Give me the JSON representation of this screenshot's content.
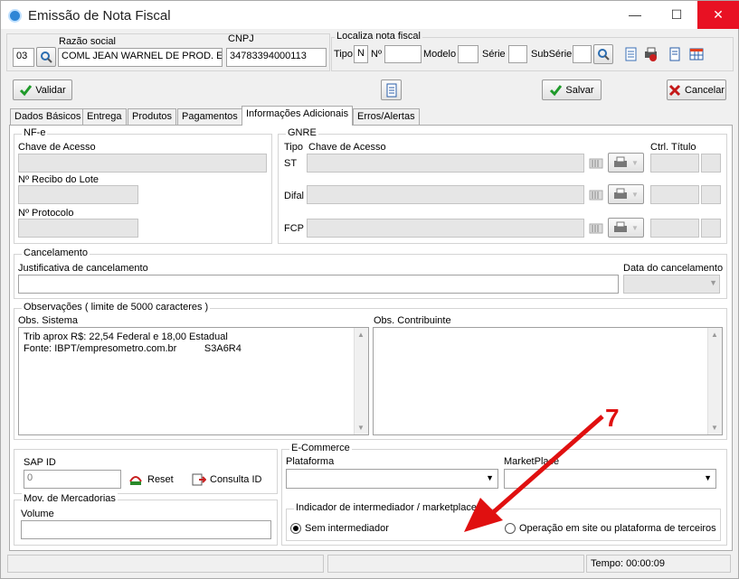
{
  "window": {
    "title": "Emissão de Nota Fiscal",
    "minimize": "—",
    "maximize": "☐",
    "close": "✕"
  },
  "header": {
    "code_value": "03",
    "razao_label": "Razão social",
    "razao_value": "COML JEAN WARNEL DE PROD. ESP.",
    "cnpj_label": "CNPJ",
    "cnpj_value": "34783394000113",
    "localiza_label": "Localiza nota fiscal",
    "tipo_label": "Tipo",
    "tipo_value": "N",
    "no_label": "Nº",
    "modelo_label": "Modelo",
    "serie_label": "Série",
    "subserie_label": "SubSérie"
  },
  "toolbar": {
    "validar": "Validar",
    "salvar": "Salvar",
    "cancelar": "Cancelar"
  },
  "tabs": [
    {
      "label": "Dados Básicos"
    },
    {
      "label": "Entrega"
    },
    {
      "label": "Produtos"
    },
    {
      "label": "Pagamentos"
    },
    {
      "label": "Informações Adicionais"
    },
    {
      "label": "Erros/Alertas"
    }
  ],
  "nfe": {
    "title": "NF-e",
    "chave_label": "Chave de Acesso",
    "recibo_label": "Nº Recibo do Lote",
    "protocolo_label": "Nº Protocolo"
  },
  "gnre": {
    "title": "GNRE",
    "tipo_label": "Tipo",
    "chave_label": "Chave de Acesso",
    "ctrl_label": "Ctrl. Título",
    "rows": [
      {
        "label": "ST"
      },
      {
        "label": "Difal"
      },
      {
        "label": "FCP"
      }
    ]
  },
  "cancelamento": {
    "title": "Cancelamento",
    "justificativa_label": "Justificativa de cancelamento",
    "data_label": "Data do cancelamento"
  },
  "observacoes": {
    "title": "Observações ( limite de 5000 caracteres )",
    "sistema_label": "Obs. Sistema",
    "sistema_line1": "Trib aprox R$: 22,54 Federal e 18,00 Estadual",
    "sistema_line2": "Fonte: IBPT/empresometro.com.br          S3A6R4",
    "contribuinte_label": "Obs. Contribuinte"
  },
  "sap": {
    "label": "SAP ID",
    "value": "0",
    "reset": "Reset",
    "consulta": "Consulta ID"
  },
  "mov": {
    "title": "Mov. de Mercadorias",
    "volume_label": "Volume"
  },
  "ecommerce": {
    "title": "E-Commerce",
    "plataforma_label": "Plataforma",
    "marketplace_label": "MarketPlace",
    "intermediador_title": "Indicador de intermediador / marketplace",
    "opt_sem": "Sem intermediador",
    "opt_terceiros": "Operação em site ou plataforma de terceiros"
  },
  "annotation": {
    "number": "7",
    "color": "#e01010"
  },
  "status": {
    "tempo": "Tempo: 00:00:09"
  }
}
